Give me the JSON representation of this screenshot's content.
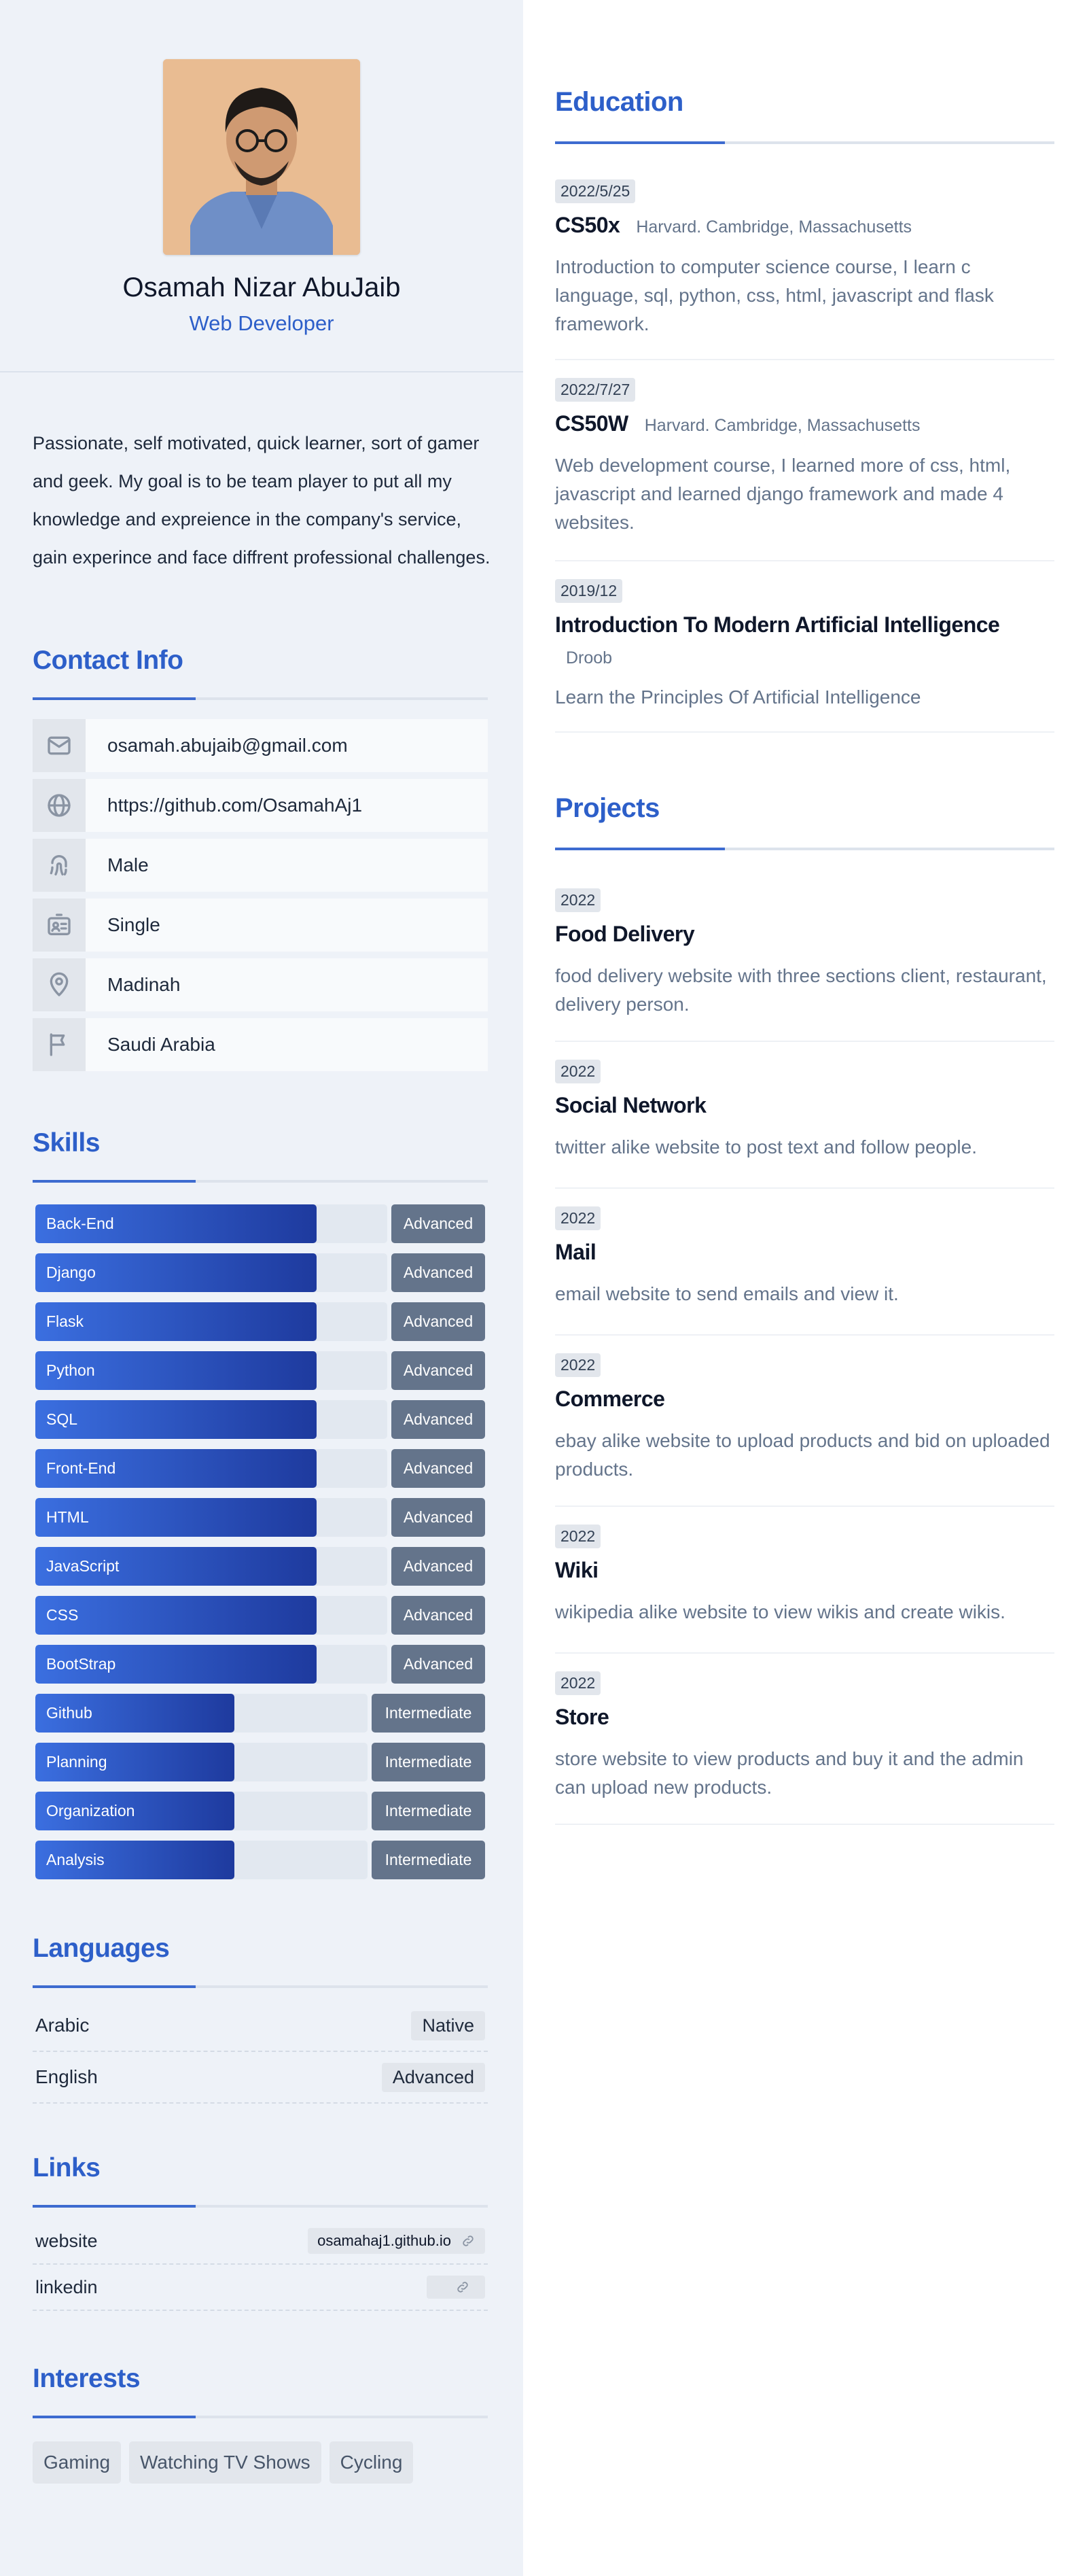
{
  "profile": {
    "name": "Osamah Nizar AbuJaib",
    "role": "Web Developer"
  },
  "about": "Passionate, self motivated, quick learner, sort of gamer and geek. My goal is to be team player to put all my knowledge and expreience in the company's service, gain experince and face diffrent professional challenges.",
  "contact": {
    "title": "Contact Info",
    "items": [
      {
        "icon": "mail-icon",
        "text": "osamah.abujaib@gmail.com"
      },
      {
        "icon": "globe-icon",
        "text": "https://github.com/OsamahAj1"
      },
      {
        "icon": "fingerprint-icon",
        "text": "Male"
      },
      {
        "icon": "id-card-icon",
        "text": "Single"
      },
      {
        "icon": "map-pin-icon",
        "text": "Madinah"
      },
      {
        "icon": "flag-icon",
        "text": "Saudi Arabia"
      }
    ]
  },
  "skills": {
    "title": "Skills",
    "items": [
      {
        "name": "Back-End",
        "level": "Advanced",
        "fill": 0.8
      },
      {
        "name": "Django",
        "level": "Advanced",
        "fill": 0.8
      },
      {
        "name": "Flask",
        "level": "Advanced",
        "fill": 0.8
      },
      {
        "name": "Python",
        "level": "Advanced",
        "fill": 0.8
      },
      {
        "name": "SQL",
        "level": "Advanced",
        "fill": 0.8
      },
      {
        "name": "Front-End",
        "level": "Advanced",
        "fill": 0.8
      },
      {
        "name": "HTML",
        "level": "Advanced",
        "fill": 0.8
      },
      {
        "name": "JavaScript",
        "level": "Advanced",
        "fill": 0.8
      },
      {
        "name": "CSS",
        "level": "Advanced",
        "fill": 0.8
      },
      {
        "name": "BootStrap",
        "level": "Advanced",
        "fill": 0.8
      },
      {
        "name": "Github",
        "level": "Intermediate",
        "fill": 0.6
      },
      {
        "name": "Planning",
        "level": "Intermediate",
        "fill": 0.6
      },
      {
        "name": "Organization",
        "level": "Intermediate",
        "fill": 0.6
      },
      {
        "name": "Analysis",
        "level": "Intermediate",
        "fill": 0.6
      }
    ]
  },
  "languages": {
    "title": "Languages",
    "items": [
      {
        "name": "Arabic",
        "level": "Native"
      },
      {
        "name": "English",
        "level": "Advanced"
      }
    ]
  },
  "links": {
    "title": "Links",
    "items": [
      {
        "label": "website",
        "value": "osamahaj1.github.io"
      },
      {
        "label": "linkedin",
        "value": ""
      }
    ]
  },
  "interests": {
    "title": "Interests",
    "items": [
      "Gaming",
      "Watching TV Shows",
      "Cycling"
    ]
  },
  "education": {
    "title": "Education",
    "items": [
      {
        "date": "2022/5/25",
        "title": "CS50x",
        "place": "Harvard. Cambridge, Massachusetts",
        "desc": "Introduction to computer science course, I learn c language, sql, python, css, html, javascript and flask framework."
      },
      {
        "date": "2022/7/27",
        "title": "CS50W",
        "place": "Harvard. Cambridge, Massachusetts",
        "desc": "Web development course, I learned more of css, html, javascript and learned django framework and made 4 websites."
      },
      {
        "date": "2019/12",
        "title": "Introduction To Modern Artificial Intelligence",
        "place": "Droob",
        "desc": "Learn the Principles Of Artificial Intelligence"
      }
    ]
  },
  "projects": {
    "title": "Projects",
    "items": [
      {
        "date": "2022",
        "title": "Food Delivery",
        "desc": "food delivery website with three sections client, restaurant, delivery person."
      },
      {
        "date": "2022",
        "title": "Social Network",
        "desc": "twitter alike website to post text and follow people."
      },
      {
        "date": "2022",
        "title": "Mail",
        "desc": "email website to send emails and view it."
      },
      {
        "date": "2022",
        "title": "Commerce",
        "desc": "ebay alike website to upload products and bid on uploaded products."
      },
      {
        "date": "2022",
        "title": "Wiki",
        "desc": "wikipedia alike website to view wikis and create wikis."
      },
      {
        "date": "2022",
        "title": "Store",
        "desc": "store website to view products and buy it and the admin can upload new products."
      }
    ]
  }
}
